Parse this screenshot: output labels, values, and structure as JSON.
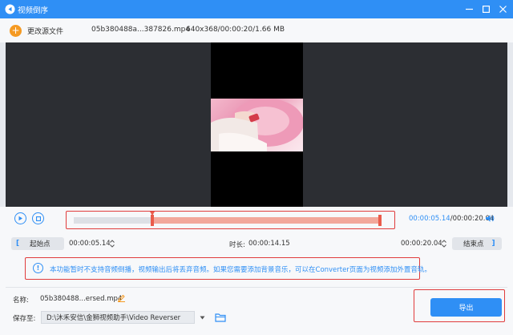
{
  "window": {
    "title": "视频倒序",
    "controls": [
      "minimize-icon",
      "maximize-icon",
      "close-icon"
    ]
  },
  "file": {
    "add_label": "更改源文件",
    "name": "05b380488a...387826.mp4",
    "meta": "640x368/00:00:20/1.66 MB"
  },
  "playback": {
    "current_time": "00:00:05.14",
    "separator": "/",
    "total_time": "00:00:20.04",
    "selection_start_fraction": 0.2565,
    "selection_end_fraction": 1.0
  },
  "range": {
    "start_label": "起始点",
    "start_value": "00:00:05.14",
    "duration_label": "时长:",
    "duration_value": "00:00:14.15",
    "end_value": "00:00:20.04",
    "end_label": "结束点"
  },
  "notice": {
    "icon": "info-icon",
    "text": "本功能暂时不支持音频倒播，视频输出后将丢弃音频。如果您需要添加背景音乐，可以在Converter页面为视频添加外置音轨。"
  },
  "output": {
    "name_label": "名称:",
    "name_value": "05b380488...ersed.mp4",
    "save_label": "保存至:",
    "save_path": "D:\\沐禾安信\\金狮视频助手\\Video Reverser",
    "export_label": "导出"
  },
  "colors": {
    "accent": "#2f8ff5",
    "highlight_border": "#e03c3c",
    "selection": "#f2a79b",
    "add_button": "#f59a23"
  }
}
